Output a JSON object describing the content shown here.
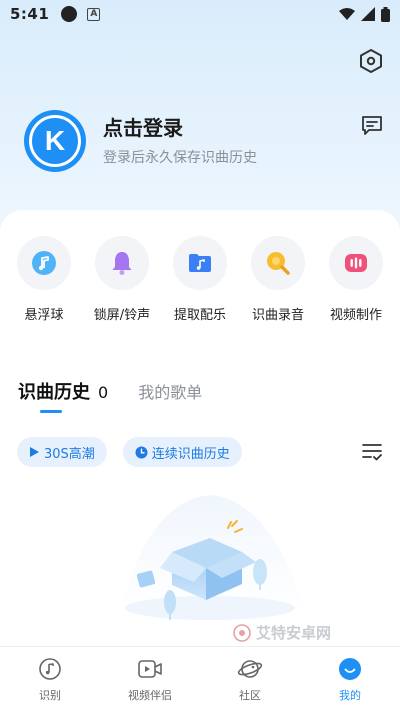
{
  "status_bar": {
    "time": "5:41",
    "a_label": "A"
  },
  "profile": {
    "avatar_letter": "K",
    "login_title": "点击登录",
    "login_subtitle": "登录后永久保存识曲历史"
  },
  "features": [
    {
      "label": "悬浮球",
      "icon": "music-note-icon",
      "color": "#3aa8f5"
    },
    {
      "label": "锁屏/铃声",
      "icon": "bell-icon",
      "color": "#a070f0"
    },
    {
      "label": "提取配乐",
      "icon": "folder-music-icon",
      "color": "#3a7ff5"
    },
    {
      "label": "识曲录音",
      "icon": "record-icon",
      "color": "#f5b52a"
    },
    {
      "label": "视频制作",
      "icon": "video-make-icon",
      "color": "#f0507a"
    }
  ],
  "tabs": {
    "active_label": "识曲历史",
    "active_count": "0",
    "inactive_label": "我的歌单"
  },
  "chips": [
    {
      "label": "30S高潮",
      "icon": "play-icon"
    },
    {
      "label": "连续识曲历史",
      "icon": "clock-icon"
    }
  ],
  "watermark": {
    "text": "艾特安卓网"
  },
  "bottom_nav": [
    {
      "label": "识别",
      "icon": "music-recognize-icon",
      "active": false
    },
    {
      "label": "视频伴侣",
      "icon": "video-icon",
      "active": false
    },
    {
      "label": "社区",
      "icon": "planet-icon",
      "active": false
    },
    {
      "label": "我的",
      "icon": "profile-icon",
      "active": true
    }
  ],
  "colors": {
    "accent": "#1e90f5",
    "chip_bg": "#e7f1fd",
    "chip_text": "#1e7be0"
  }
}
